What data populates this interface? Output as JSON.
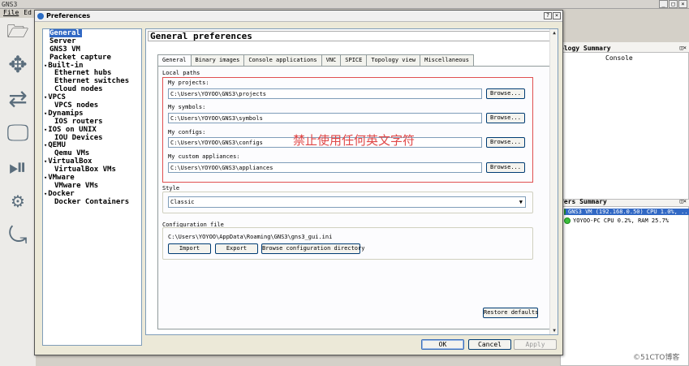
{
  "app": {
    "title": "GNS3",
    "menu": [
      "File",
      "Ed"
    ],
    "window_controls": [
      "_",
      "□",
      "×"
    ]
  },
  "right_panel": {
    "topology_summary_title": "ology Summary",
    "topology_columns": [
      "",
      "Console"
    ],
    "servers_summary_title": "vers Summary",
    "servers": [
      {
        "label": "GNS3 VM (192.168.0.50) CPU 1.0%, ..."
      },
      {
        "label": "YOYOO-PC CPU 0.2%, RAM 25.7%"
      }
    ],
    "panel_controls": [
      "◫",
      "×"
    ]
  },
  "dialog": {
    "title": "Preferences",
    "controls": [
      "?",
      "×"
    ],
    "nav": [
      {
        "label": "General",
        "indent": 0,
        "selected": true
      },
      {
        "label": "Server",
        "indent": 0
      },
      {
        "label": "GNS3 VM",
        "indent": 0
      },
      {
        "label": "Packet capture",
        "indent": 0
      },
      {
        "label": "Built-in",
        "indent": 0,
        "expander": true
      },
      {
        "label": "Ethernet hubs",
        "indent": 1
      },
      {
        "label": "Ethernet switches",
        "indent": 1
      },
      {
        "label": "Cloud nodes",
        "indent": 1
      },
      {
        "label": "VPCS",
        "indent": 0,
        "expander": true
      },
      {
        "label": "VPCS nodes",
        "indent": 1
      },
      {
        "label": "Dynamips",
        "indent": 0,
        "expander": true
      },
      {
        "label": "IOS routers",
        "indent": 1
      },
      {
        "label": "IOS on UNIX",
        "indent": 0,
        "expander": true
      },
      {
        "label": "IOU Devices",
        "indent": 1
      },
      {
        "label": "QEMU",
        "indent": 0,
        "expander": true
      },
      {
        "label": "Qemu VMs",
        "indent": 1
      },
      {
        "label": "VirtualBox",
        "indent": 0,
        "expander": true
      },
      {
        "label": "VirtualBox VMs",
        "indent": 1
      },
      {
        "label": "VMware",
        "indent": 0,
        "expander": true
      },
      {
        "label": "VMware VMs",
        "indent": 1
      },
      {
        "label": "Docker",
        "indent": 0,
        "expander": true
      },
      {
        "label": "Docker Containers",
        "indent": 1
      }
    ],
    "page_title": "General preferences",
    "tabs": [
      {
        "label": "General",
        "active": true
      },
      {
        "label": "Binary images"
      },
      {
        "label": "Console applications"
      },
      {
        "label": "VNC"
      },
      {
        "label": "SPICE"
      },
      {
        "label": "Topology view"
      },
      {
        "label": "Miscellaneous"
      }
    ],
    "local_paths": {
      "heading": "Local paths",
      "projects_label": "My projects:",
      "projects_value": "C:\\Users\\YOYOO\\GNS3\\projects",
      "symbols_label": "My symbols:",
      "symbols_value": "C:\\Users\\YOYOO\\GNS3\\symbols",
      "configs_label": "My configs:",
      "configs_value": "C:\\Users\\YOYOO\\GNS3\\configs",
      "appliances_label": "My custom appliances:",
      "appliances_value": "C:\\Users\\YOYOO\\GNS3\\appliances",
      "browse_label": "Browse..."
    },
    "watermark": "禁止使用任何英文字符",
    "style": {
      "heading": "Style",
      "selected": "Classic"
    },
    "config_file": {
      "heading": "Configuration file",
      "path": "C:\\Users\\YOYOO\\AppData\\Roaming\\GNS3\\gns3_gui.ini",
      "import_label": "Import",
      "export_label": "Export",
      "browse_dir_label": "Browse configuration directory"
    },
    "restore_defaults_label": "Restore defaults",
    "ok_label": "OK",
    "cancel_label": "Cancel",
    "apply_label": "Apply"
  },
  "footer_watermark": "©51CTO博客"
}
